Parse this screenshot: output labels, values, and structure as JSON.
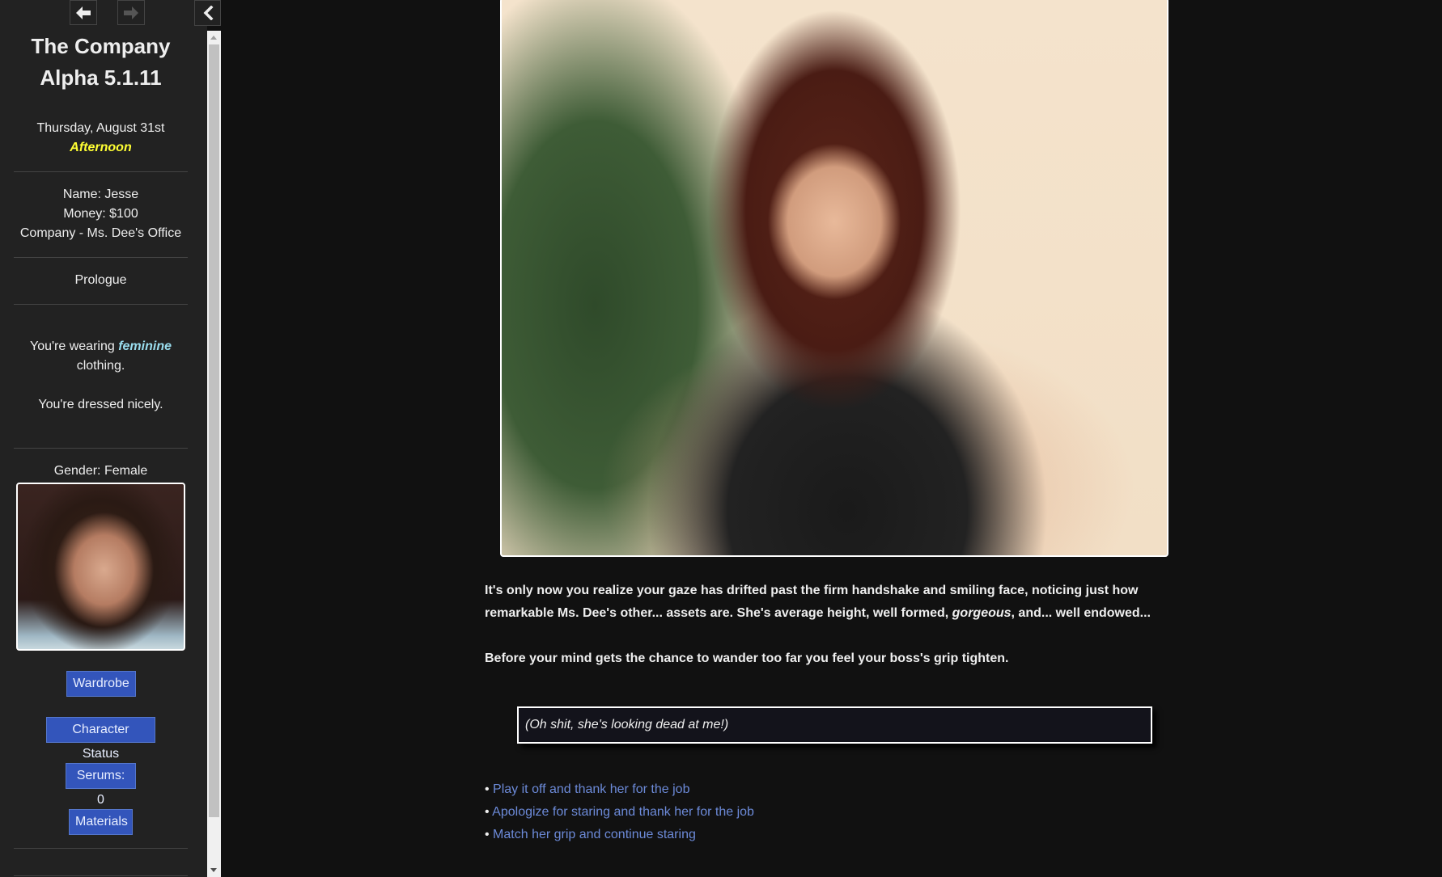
{
  "nav": {
    "back_icon": "arrow-left-icon",
    "forward_icon": "arrow-right-icon",
    "collapse_icon": "chevron-left-icon"
  },
  "sidebar": {
    "title_line1": "The Company",
    "title_line2": "Alpha 5.1.11",
    "date": "Thursday, August 31st",
    "time_of_day": "Afternoon",
    "name": "Name: Jesse",
    "money": "Money: $100",
    "location": "Company - Ms. Dee's Office",
    "chapter": "Prologue",
    "wearing_prefix": "You're wearing ",
    "wearing_style": "feminine",
    "wearing_suffix": "clothing.",
    "dressed": "You're dressed nicely.",
    "gender": "Gender: Female",
    "portrait_alt": "Player character portrait",
    "buttons": [
      {
        "label": "Wardrobe"
      },
      {
        "label": "Character Status"
      },
      {
        "label": "Serums: 0"
      },
      {
        "label": "Materials"
      }
    ]
  },
  "main": {
    "image_alt": "Ms. Dee portrait",
    "para1_a": "It's only now you realize your gaze has drifted past the firm handshake and smiling face, noticing just how remarkable Ms. Dee's other... assets are. She's average height, well formed, ",
    "para1_em": "gorgeous",
    "para1_b": ", and... well endowed...",
    "para2": "Before your mind gets the chance to wander too far you feel your boss's grip tighten.",
    "thought": "(Oh shit, she's looking dead at me!)",
    "bullet": "• ",
    "choices": [
      {
        "label": "Play it off and thank her for the job"
      },
      {
        "label": "Apologize for staring and thank her for the job"
      },
      {
        "label": "Match her grip and continue staring"
      }
    ]
  },
  "colors": {
    "sidebar_bg": "#222222",
    "main_bg": "#111111",
    "accent_yellow": "#ffff33",
    "accent_cyan": "#99ddee",
    "button_blue": "#3355bb",
    "link_blue": "#6c8ad8"
  }
}
